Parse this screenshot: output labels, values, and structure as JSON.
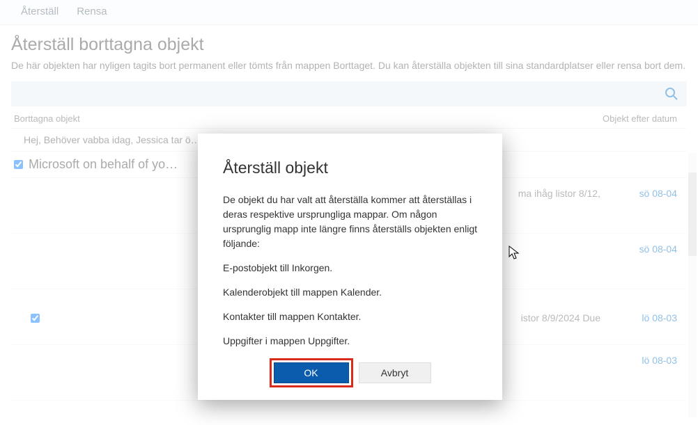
{
  "toolbar": {
    "restore": "Återställ",
    "clear": "Rensa"
  },
  "page": {
    "title": "Återställ borttagna objekt",
    "description": "De här objekten har nyligen tagits bort permanent eller tömts från mappen Borttaget. Du kan återställa objekten till sina standardplatser eller rensa bort dem."
  },
  "headers": {
    "left": "Borttagna objekt",
    "right": "Objekt efter datum"
  },
  "list": {
    "preview_truncated": "Hej, Behöver vabba idag, Jessica tar ö…",
    "group_label": "Microsoft on behalf of yo…",
    "items": [
      {
        "body": "ma ihåg listor 8/12,",
        "date": "sö 08-04"
      },
      {
        "body": "",
        "date": "sö 08-04"
      },
      {
        "body": "istor 8/9/2024 Due",
        "date": "lö 08-03"
      },
      {
        "body": "",
        "date": "lö 08-03"
      }
    ]
  },
  "modal": {
    "title": "Återställ objekt",
    "para1": "De objekt du har valt att återställa kommer att återställas i deras respektive ursprungliga mappar. Om någon ursprunglig mapp inte längre finns återställs objekten enligt följande:",
    "line1": "E-postobjekt till Inkorgen.",
    "line2": "Kalenderobjekt till mappen Kalender.",
    "line3": "Kontakter till mappen Kontakter.",
    "line4": "Uppgifter i mappen Uppgifter.",
    "ok": "OK",
    "cancel": "Avbryt"
  }
}
